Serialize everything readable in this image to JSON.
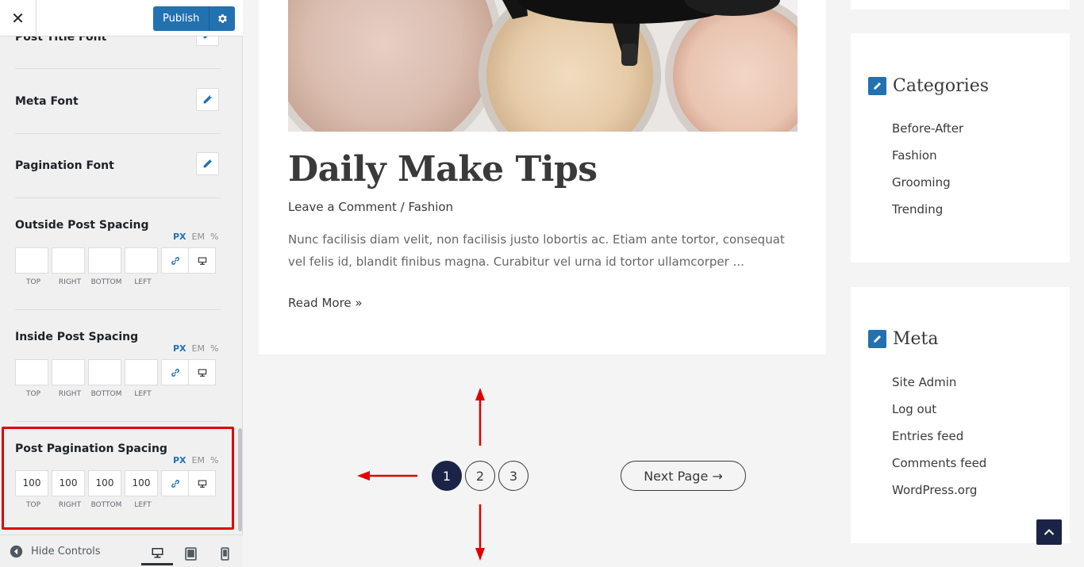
{
  "sidebar": {
    "publish_label": "Publish",
    "controls": {
      "post_title_font": "Post Title Font",
      "meta_font": "Meta Font",
      "pagination_font": "Pagination Font"
    },
    "units": [
      "PX",
      "EM",
      "%"
    ],
    "side_labels": [
      "TOP",
      "RIGHT",
      "BOTTOM",
      "LEFT"
    ],
    "outside_spacing": {
      "title": "Outside Post Spacing",
      "values": [
        "",
        "",
        "",
        ""
      ]
    },
    "inside_spacing": {
      "title": "Inside Post Spacing",
      "values": [
        "",
        "",
        "",
        ""
      ]
    },
    "pagination_spacing": {
      "title": "Post Pagination Spacing",
      "values": [
        "100",
        "100",
        "100",
        "100"
      ]
    },
    "footer": {
      "hide_controls": "Hide Controls"
    }
  },
  "post": {
    "title": "Daily Make Tips",
    "meta_comment": "Leave a Comment",
    "meta_separator": " / ",
    "meta_category": "Fashion",
    "excerpt": "Nunc facilisis diam velit, non facilisis justo lobortis ac. Etiam ante tortor, consequat vel felis id, blandit finibus magna. Curabitur vel urna id tortor ullamcorper ...",
    "read_more": "Read More »"
  },
  "pagination": {
    "pages": [
      "1",
      "2",
      "3"
    ],
    "current": "1",
    "next": "Next Page →"
  },
  "widgets": {
    "categories": {
      "title": "Categories",
      "items": [
        "Before-After",
        "Fashion",
        "Grooming",
        "Trending"
      ]
    },
    "meta": {
      "title": "Meta",
      "items": [
        "Site Admin",
        "Log out",
        "Entries feed",
        "Comments feed",
        "WordPress.org"
      ]
    }
  },
  "colors": {
    "accent": "#2271b1",
    "pagination_active": "#1b2447",
    "annotation": "#e00000"
  }
}
